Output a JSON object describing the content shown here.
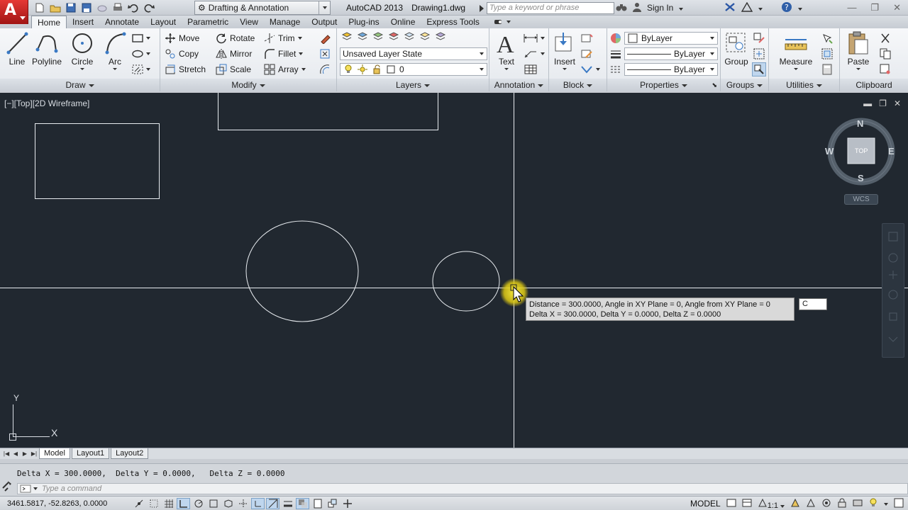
{
  "titlebar": {
    "workspace": "Drafting & Annotation",
    "app_name": "AutoCAD 2013",
    "file_name": "Drawing1.dwg",
    "search_placeholder": "Type a keyword or phrase",
    "sign_in": "Sign In"
  },
  "ribbon_tabs": [
    "Home",
    "Insert",
    "Annotate",
    "Layout",
    "Parametric",
    "View",
    "Manage",
    "Output",
    "Plug-ins",
    "Online",
    "Express Tools"
  ],
  "active_tab": "Home",
  "panels": {
    "draw": {
      "title": "Draw",
      "line": "Line",
      "polyline": "Polyline",
      "circle": "Circle",
      "arc": "Arc"
    },
    "modify": {
      "title": "Modify",
      "move": "Move",
      "rotate": "Rotate",
      "trim": "Trim",
      "copy": "Copy",
      "mirror": "Mirror",
      "fillet": "Fillet",
      "stretch": "Stretch",
      "scale": "Scale",
      "array": "Array"
    },
    "layers": {
      "title": "Layers",
      "layer_state": "Unsaved Layer State",
      "current_layer": "0"
    },
    "annotation": {
      "title": "Annotation",
      "text": "Text"
    },
    "block": {
      "title": "Block",
      "insert": "Insert"
    },
    "properties": {
      "title": "Properties",
      "color": "ByLayer",
      "linetype": "ByLayer",
      "lineweight": "ByLayer"
    },
    "groups": {
      "title": "Groups",
      "group": "Group"
    },
    "utilities": {
      "title": "Utilities",
      "measure": "Measure"
    },
    "clipboard": {
      "title": "Clipboard",
      "paste": "Paste"
    }
  },
  "viewport": {
    "label": "[−][Top][2D Wireframe]",
    "viewcube": {
      "north": "N",
      "south": "S",
      "east": "E",
      "west": "W",
      "face": "TOP",
      "wcs": "WCS"
    },
    "ucs": {
      "x": "X",
      "y": "Y"
    }
  },
  "tooltip": {
    "line1": "Distance = 300.0000,  Angle in XY Plane = 0,  Angle from XY Plane = 0",
    "line2": "Delta X = 300.0000,  Delta Y = 0.0000,   Delta Z = 0.0000"
  },
  "dynamic_input": "C",
  "layout_tabs": [
    "Model",
    "Layout1",
    "Layout2"
  ],
  "command": {
    "history": "Delta X = 300.0000,  Delta Y = 0.0000,   Delta Z = 0.0000",
    "placeholder": "Type a command"
  },
  "status": {
    "coordinates": "3461.5817, -52.8263, 0.0000",
    "space": "MODEL",
    "scale": "1:1"
  }
}
